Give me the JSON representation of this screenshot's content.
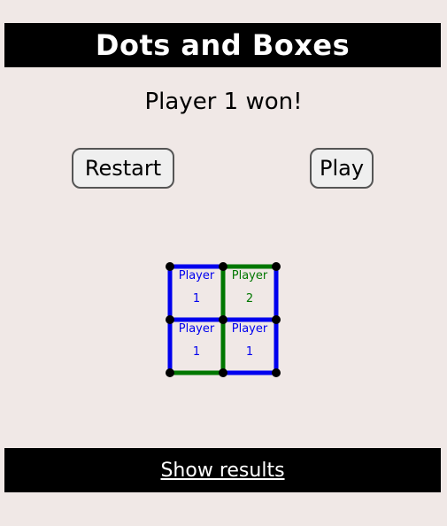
{
  "header": {
    "title": "Dots and Boxes"
  },
  "status": {
    "text": "Player 1 won!"
  },
  "buttons": {
    "restart": "Restart",
    "play": "Play"
  },
  "board": {
    "rows": 2,
    "cols": 2,
    "colors": {
      "player1": "#0000ee",
      "player2": "#007700",
      "dot": "#000000"
    },
    "horizontal_lines": [
      [
        "player1",
        "player2"
      ],
      [
        "player1",
        "player1"
      ],
      [
        "player2",
        "player1"
      ]
    ],
    "vertical_lines": [
      [
        "player1",
        "player2",
        "player1"
      ],
      [
        "player1",
        "player2",
        "player1"
      ]
    ],
    "boxes": [
      {
        "owner": "player1",
        "line1": "Player",
        "line2": "1"
      },
      {
        "owner": "player2",
        "line1": "Player",
        "line2": "2"
      },
      {
        "owner": "player1",
        "line1": "Player",
        "line2": "1"
      },
      {
        "owner": "player1",
        "line1": "Player",
        "line2": "1"
      }
    ]
  },
  "footer": {
    "link": "Show results"
  }
}
